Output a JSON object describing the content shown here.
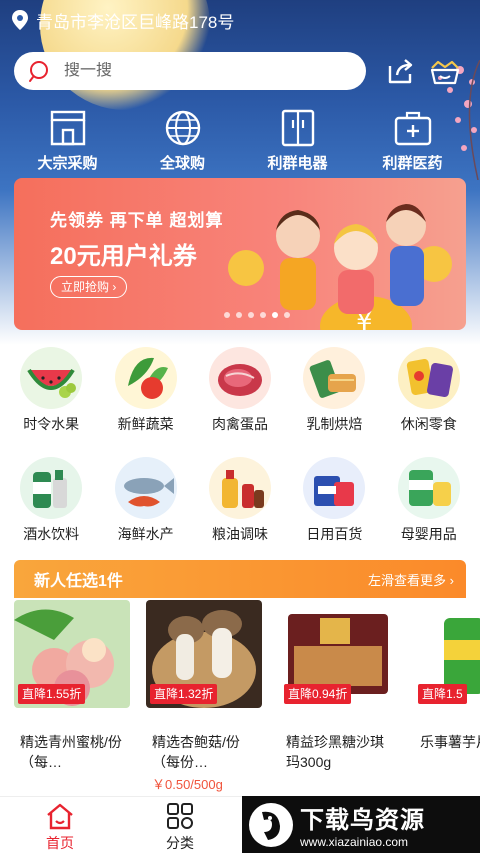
{
  "location": {
    "address": "青岛市李沧区巨峰路178号"
  },
  "search": {
    "placeholder": "搜一搜"
  },
  "quick_nav": [
    {
      "label": "大宗采购",
      "icon": "store-icon"
    },
    {
      "label": "全球购",
      "icon": "globe-icon"
    },
    {
      "label": "利群电器",
      "icon": "fridge-icon"
    },
    {
      "label": "利群医药",
      "icon": "medical-kit-icon"
    }
  ],
  "banner": {
    "line1": "先领券 再下单 超划算",
    "line2": "20元用户礼券",
    "button": "立即抢购 ›",
    "slide_count": 6,
    "active_slide": 5
  },
  "categories": [
    {
      "label": "时令水果",
      "icon": "watermelon-icon"
    },
    {
      "label": "新鲜蔬菜",
      "icon": "vegetables-icon"
    },
    {
      "label": "肉禽蛋品",
      "icon": "meat-icon"
    },
    {
      "label": "乳制烘焙",
      "icon": "bread-icon"
    },
    {
      "label": "休闲零食",
      "icon": "snacks-icon"
    },
    {
      "label": "酒水饮料",
      "icon": "beer-icon"
    },
    {
      "label": "海鲜水产",
      "icon": "seafood-icon"
    },
    {
      "label": "粮油调味",
      "icon": "oil-icon"
    },
    {
      "label": "日用百货",
      "icon": "daily-goods-icon"
    },
    {
      "label": "母婴用品",
      "icon": "baby-goods-icon"
    }
  ],
  "promo": {
    "title": "新人任选1件",
    "more": "左滑查看更多 ›"
  },
  "products": [
    {
      "badge": "直降1.55折",
      "name": "精选青州蜜桃/份（每…",
      "price": ""
    },
    {
      "badge": "直降1.32折",
      "name": "精选杏鲍菇/份（每份…",
      "price": "￥0.50/500g"
    },
    {
      "badge": "直降0.94折",
      "name": "精益珍黑糖沙琪玛300g",
      "price": ""
    },
    {
      "badge": "直降1.5",
      "name": "乐事薯芋片沁",
      "price": ""
    }
  ],
  "tabbar": [
    {
      "label": "首页",
      "icon": "home-icon",
      "active": true
    },
    {
      "label": "分类",
      "icon": "category-grid-icon",
      "active": false
    }
  ],
  "watermark": {
    "title": "下载鸟资源",
    "url": "www.xiazainiao.com"
  },
  "colors": {
    "accent": "#e8232f",
    "promo": "#fb8a2a",
    "banner": "#f56f5c",
    "hero_top": "#1f3f80"
  }
}
